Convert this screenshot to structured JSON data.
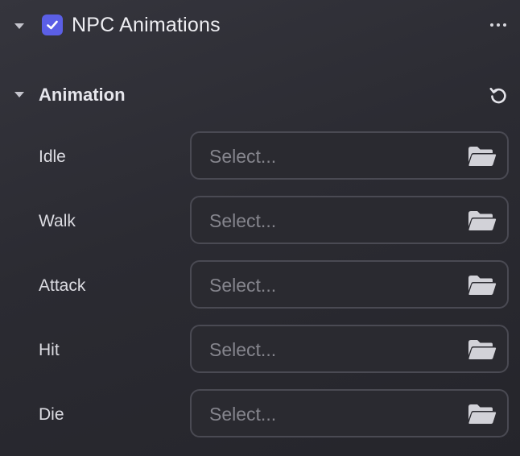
{
  "component": {
    "title": "NPC Animations",
    "enabled": true,
    "accent_color": "#5b5fe6"
  },
  "section": {
    "title": "Animation"
  },
  "fields": [
    {
      "label": "Idle",
      "placeholder": "Select..."
    },
    {
      "label": "Walk",
      "placeholder": "Select..."
    },
    {
      "label": "Attack",
      "placeholder": "Select..."
    },
    {
      "label": "Hit",
      "placeholder": "Select..."
    },
    {
      "label": "Die",
      "placeholder": "Select..."
    }
  ],
  "icons": {
    "collapse": "caret-down-icon",
    "checkbox": "check-icon",
    "menu": "more-horizontal-icon",
    "reset": "reset-icon",
    "browse": "folder-icon"
  }
}
